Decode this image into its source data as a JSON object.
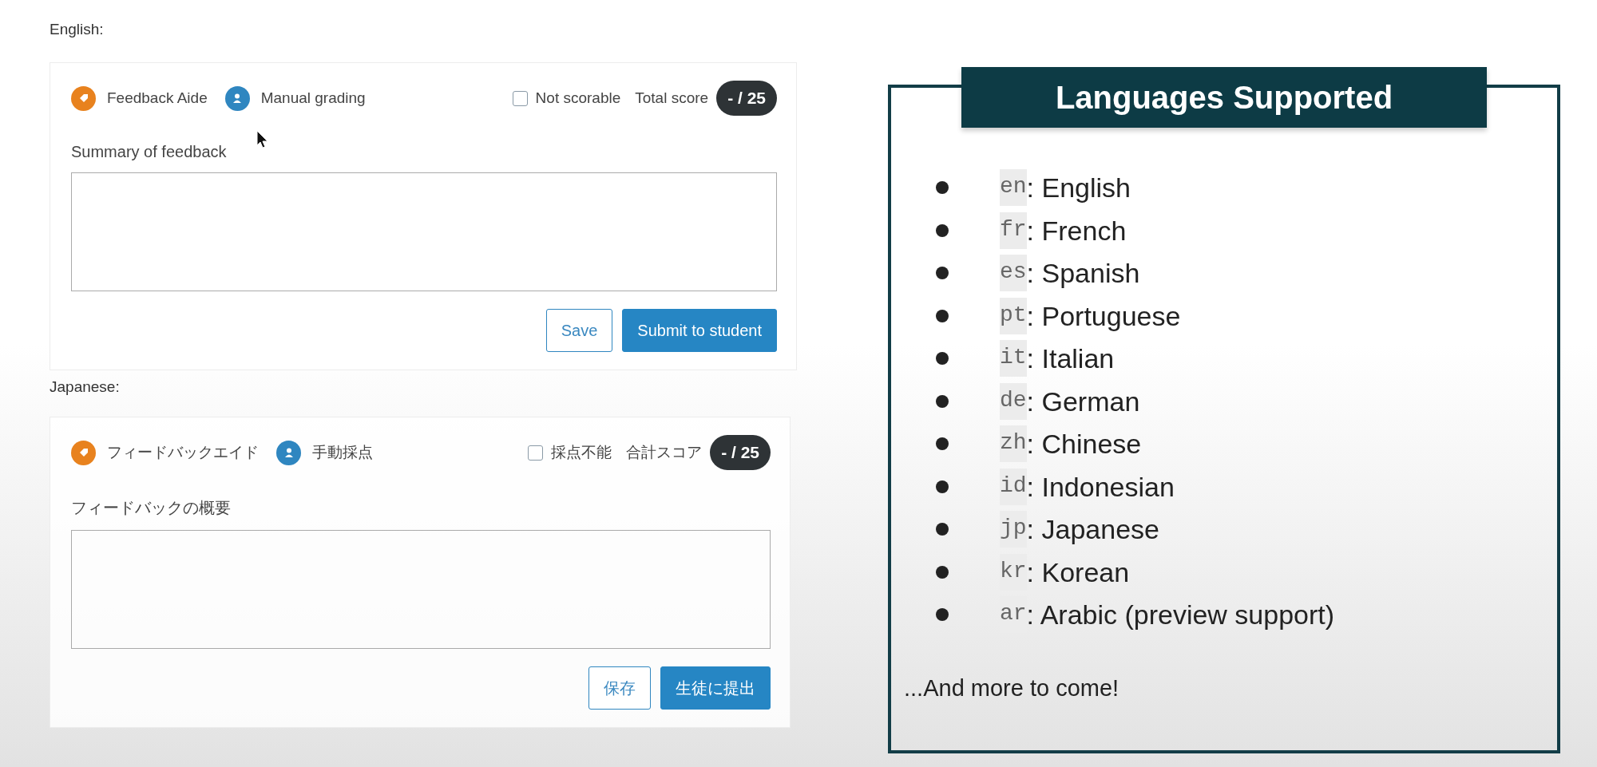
{
  "sections": [
    {
      "heading": "English:",
      "card": {
        "modes": [
          {
            "label": "Feedback Aide",
            "kind": "ai"
          },
          {
            "label": "Manual grading",
            "kind": "person"
          }
        ],
        "not_scorable": {
          "label": "Not scorable",
          "checked": false
        },
        "total_label": "Total score",
        "score": "- / 25",
        "summary_label": "Summary of feedback",
        "buttons": [
          {
            "label": "Save",
            "kind": "secondary"
          },
          {
            "label": "Submit to student",
            "kind": "primary"
          }
        ]
      }
    },
    {
      "heading": "Japanese:",
      "card": {
        "modes": [
          {
            "label": "フィードバックエイド",
            "kind": "ai"
          },
          {
            "label": "手動採点",
            "kind": "person"
          }
        ],
        "not_scorable": {
          "label": "採点不能",
          "checked": false
        },
        "total_label": "合計スコア",
        "score": "- / 25",
        "summary_label": "フィードバックの概要",
        "buttons": [
          {
            "label": "保存",
            "kind": "secondary"
          },
          {
            "label": "生徒に提出",
            "kind": "primary"
          }
        ]
      }
    }
  ],
  "languages_panel": {
    "title": "Languages Supported",
    "languages": [
      {
        "code": "en",
        "name": ": English"
      },
      {
        "code": "fr",
        "name": ": French"
      },
      {
        "code": "es",
        "name": ": Spanish"
      },
      {
        "code": "pt",
        "name": ": Portuguese"
      },
      {
        "code": "it",
        "name": ": Italian"
      },
      {
        "code": "de",
        "name": ": German"
      },
      {
        "code": "zh",
        "name": ": Chinese"
      },
      {
        "code": "id",
        "name": ": Indonesian"
      },
      {
        "code": "jp",
        "name": ": Japanese"
      },
      {
        "code": "kr",
        "name": ": Korean"
      },
      {
        "code": "ar",
        "name": ": Arabic (preview support)"
      }
    ],
    "footer": "...And more to come!"
  }
}
